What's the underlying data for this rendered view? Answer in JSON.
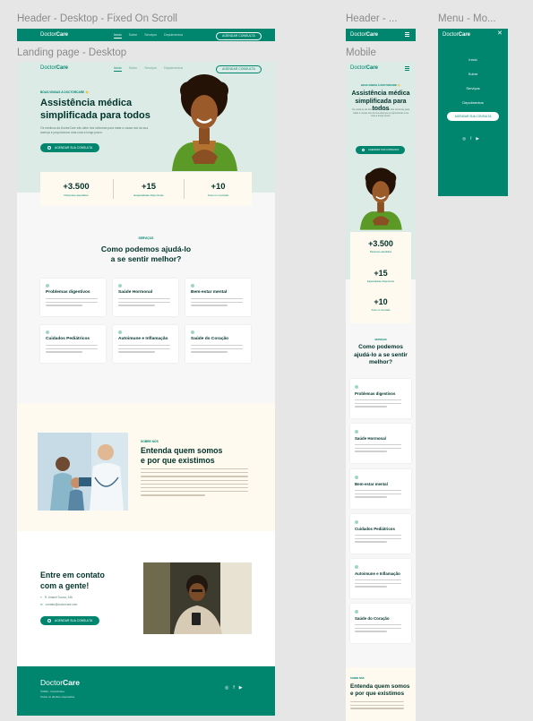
{
  "frames": {
    "header_desktop": "Header - Desktop - Fixed On Scroll",
    "landing_desktop": "Landing page - Desktop",
    "header_mobile": "Header - ...",
    "mobile": "Mobile",
    "menu_mobile": "Menu - Mo..."
  },
  "brand": {
    "light": "Doctor",
    "bold": "Care"
  },
  "nav": [
    "Início",
    "Sobre",
    "Serviços",
    "Depoimentos"
  ],
  "cta_pill": "AGENDAR CONSULTA",
  "hero": {
    "eyebrow": "BOAS-VINDAS À DOCTORCARE 👋",
    "title_line1": "Assistência médica",
    "title_line2": "simplificada para todos",
    "text": "Os médicos da DoctorCare vão além dos sintomas para tratar a causa raiz da sua doença e proporcionar uma cura a longo prazo.",
    "button": "AGENDAR SUA CONSULTA"
  },
  "stats": [
    {
      "value": "+3.500",
      "label": "Pacientes atendidos"
    },
    {
      "value": "+15",
      "label": "Especialistas disponíveis"
    },
    {
      "value": "+10",
      "label": "Anos no mercado"
    }
  ],
  "services": {
    "eyebrow": "SERVIÇOS",
    "title_line1": "Como podemos ajudá-lo",
    "title_line2": "a se sentir melhor?",
    "mobile_title": [
      "Como podemos",
      "ajudá-lo a se sentir",
      "melhor?"
    ],
    "items": [
      "Problemas digestivos",
      "Saúde Hormonal",
      "Bem-estar mental",
      "Cuidados Pediátricos",
      "Autoimune e Inflamação",
      "Saúde do Coração"
    ]
  },
  "about": {
    "eyebrow": "SOBRE NÓS",
    "title_line1": "Entenda quem somos",
    "title_line2": "e por que existimos"
  },
  "contact": {
    "title_line1": "Entre em contato",
    "title_line2": "com a gente!",
    "address": "R. Amauri Souza, 346",
    "email": "contato@doctorcare.com",
    "button": "AGENDAR SUA CONSULTA"
  },
  "footer": {
    "line1": "©2022 - DoctorCare.",
    "line2": "Todos os direitos reservados."
  },
  "menu_mobile": {
    "items": [
      "Início",
      "Sobre",
      "Serviços",
      "Depoimentos"
    ],
    "button": "AGENDAR SUA CONSULTA"
  },
  "colors": {
    "primary": "#00856f",
    "dark": "#00332a",
    "hero_bg": "#dcebe6",
    "cream": "#fffaf0",
    "page_bg": "#f7f7f7"
  },
  "icons": [
    "menu-icon",
    "close-icon",
    "instagram-icon",
    "facebook-icon",
    "youtube-icon",
    "whatsapp-icon",
    "map-pin-icon",
    "mail-icon"
  ]
}
